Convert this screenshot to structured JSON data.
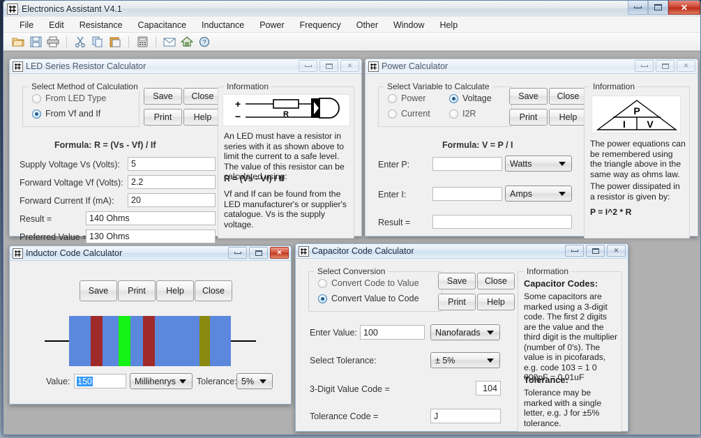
{
  "app": {
    "title": "Electronics Assistant V4.1",
    "icon": "electronics-app-icon",
    "window_controls": {
      "minimize": "minimize-icon",
      "maximize": "maximize-icon",
      "close": "close-icon"
    }
  },
  "menubar": {
    "items": [
      {
        "label": "File"
      },
      {
        "label": "Edit"
      },
      {
        "label": "Resistance"
      },
      {
        "label": "Capacitance"
      },
      {
        "label": "Inductance"
      },
      {
        "label": "Power"
      },
      {
        "label": "Frequency"
      },
      {
        "label": "Other"
      },
      {
        "label": "Window"
      },
      {
        "label": "Help"
      }
    ]
  },
  "toolbar": {
    "buttons": [
      {
        "name": "open-icon",
        "glyph": "📂"
      },
      {
        "name": "save-icon",
        "glyph": "💾"
      },
      {
        "name": "print-icon",
        "glyph": "🖨"
      },
      {
        "name": "cut-icon",
        "glyph": "✂"
      },
      {
        "name": "copy-icon",
        "glyph": "⧉"
      },
      {
        "name": "paste-icon",
        "glyph": "📋"
      },
      {
        "name": "calculator-icon",
        "glyph": "🖩"
      },
      {
        "name": "mail-icon",
        "glyph": "✉"
      },
      {
        "name": "home-icon",
        "glyph": "🏠"
      },
      {
        "name": "help-icon",
        "glyph": "?"
      }
    ]
  },
  "led_window": {
    "title": "LED Series Resistor Calculator",
    "group_title": "Select Method of Calculation",
    "radios": [
      {
        "label": "From LED Type",
        "checked": false
      },
      {
        "label": "From Vf and If",
        "checked": true
      }
    ],
    "buttons": {
      "save": "Save",
      "close": "Close",
      "print": "Print",
      "help": "Help"
    },
    "formula": "Formula: R = (Vs - Vf) / If",
    "fields": [
      {
        "label": "Supply Voltage Vs (Volts):",
        "value": "5"
      },
      {
        "label": "Forward Voltage Vf (Volts):",
        "value": "2.2"
      },
      {
        "label": "Forward Current If (mA):",
        "value": "20"
      }
    ],
    "results": [
      {
        "label": "Result =",
        "value": "140 Ohms"
      },
      {
        "label": "Preferred Value =",
        "value": "130 Ohms"
      }
    ],
    "info": {
      "title": "Information",
      "diagram": "led-resistor-schematic",
      "diagram_labels": {
        "plus": "+",
        "minus": "−",
        "resistor": "R"
      },
      "paragraph1": "An LED must have a resistor in series with it as shown above to limit the current to a safe level. The value of this resistor can be calculated using:",
      "formula": "R = (Vs - Vf) / If",
      "paragraph2": "Vf and If can be found from the LED manufacturer's or supplier's catalogue. Vs is the supply voltage."
    }
  },
  "power_window": {
    "title": "Power Calculator",
    "group_title": "Select Variable to Calculate",
    "radios": [
      {
        "label": "Power",
        "checked": false
      },
      {
        "label": "Voltage",
        "checked": true
      },
      {
        "label": "Current",
        "checked": false
      },
      {
        "label": "I2R",
        "checked": false
      }
    ],
    "buttons": {
      "save": "Save",
      "close": "Close",
      "print": "Print",
      "help": "Help"
    },
    "formula": "Formula: V = P / I",
    "fields": [
      {
        "label": "Enter P:",
        "value": "",
        "unit": "Watts"
      },
      {
        "label": "Enter I:",
        "value": "",
        "unit": "Amps"
      }
    ],
    "result": {
      "label": "Result =",
      "value": ""
    },
    "info": {
      "title": "Information",
      "diagram": "power-triangle",
      "triangle_labels": {
        "top": "P",
        "left": "I",
        "right": "V"
      },
      "paragraph1": "The power equations can be remembered using the triangle above in the same way as ohms law.",
      "paragraph2": "The power dissipated in a resistor is given by:",
      "formula": "P = I^2 * R"
    }
  },
  "inductor_window": {
    "title": "Inductor Code Calculator",
    "buttons": {
      "save": "Save",
      "print": "Print",
      "help": "Help",
      "close": "Close"
    },
    "body_color": "#5b87dd",
    "bands": [
      {
        "color": "#a02a2a",
        "name": "brown-red-band"
      },
      {
        "color": "#15f215",
        "name": "green-band"
      },
      {
        "color": "#a02a2a",
        "name": "brown-red-band"
      },
      {
        "color": "#8a8a10",
        "name": "olive-gold-band"
      }
    ],
    "value_label": "Value:",
    "value": "150",
    "value_selected": true,
    "unit": "Millihenrys",
    "tolerance_label": "Tolerance:",
    "tolerance": "5%"
  },
  "capacitor_window": {
    "title": "Capacitor Code Calculator",
    "group_title": "Select Conversion",
    "radios": [
      {
        "label": "Convert Code to Value",
        "checked": false
      },
      {
        "label": "Convert Value to Code",
        "checked": true
      }
    ],
    "buttons": {
      "save": "Save",
      "close": "Close",
      "print": "Print",
      "help": "Help"
    },
    "fields": [
      {
        "label": "Enter Value:",
        "value": "100",
        "unit": "Nanofarads"
      }
    ],
    "tolerance_label": "Select Tolerance:",
    "tolerance": "± 5%",
    "results": [
      {
        "label": "3-Digit Value Code =",
        "value": "104"
      },
      {
        "label": "Tolerance Code =",
        "value": "J"
      }
    ],
    "info": {
      "title": "Information",
      "heading1": "Capacitor Codes:",
      "paragraph1": "Some capacitors are marked using a 3-digit code. The first 2 digits are the value and the third digit is the multiplier (number of 0's). The value is in picofarads, e.g. code 103 = 1 0 000pF = 0.01uF",
      "heading2": "Tolerance:",
      "paragraph2": "Tolerance may be marked with a single letter, e.g. J for ±5% tolerance."
    }
  }
}
